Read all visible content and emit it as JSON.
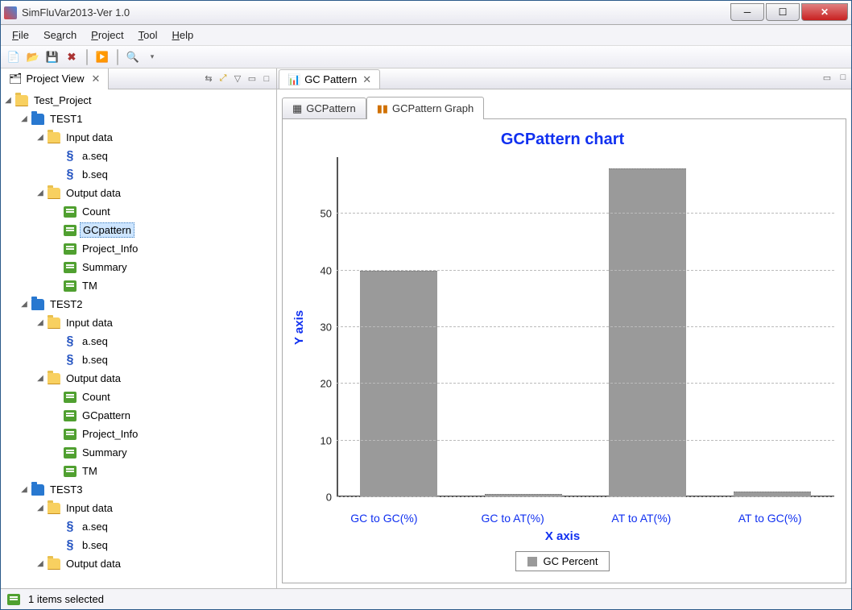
{
  "app": {
    "title": "SimFluVar2013-Ver 1.0"
  },
  "menu": {
    "file": "File",
    "search": "Search",
    "project": "Project",
    "tool": "Tool",
    "help": "Help"
  },
  "projectView": {
    "title": "Project View"
  },
  "tree": {
    "root": "Test_Project",
    "folders": [
      {
        "name": "TEST1",
        "input": "Input data",
        "output": "Output data",
        "seqs": [
          "a.seq",
          "b.seq"
        ],
        "outputs": [
          "Count",
          "GCpattern",
          "Project_Info",
          "Summary",
          "TM"
        ],
        "selected": "GCpattern"
      },
      {
        "name": "TEST2",
        "input": "Input data",
        "output": "Output data",
        "seqs": [
          "a.seq",
          "b.seq"
        ],
        "outputs": [
          "Count",
          "GCpattern",
          "Project_Info",
          "Summary",
          "TM"
        ]
      },
      {
        "name": "TEST3",
        "input": "Input data",
        "output": "Output data",
        "seqs": [
          "a.seq",
          "b.seq"
        ]
      }
    ]
  },
  "editor": {
    "tab": "GC Pattern",
    "innerTabs": {
      "table": "GCPattern",
      "graph": "GCPattern Graph"
    }
  },
  "chart_data": {
    "type": "bar",
    "title": "GCPattern chart",
    "xlabel": "X axis",
    "ylabel": "Y axis",
    "categories": [
      "GC to GC(%)",
      "GC to AT(%)",
      "AT to AT(%)",
      "AT to GC(%)"
    ],
    "values": [
      40,
      0.6,
      58,
      1.0
    ],
    "legend": "GC Percent",
    "ylim": [
      0,
      60
    ],
    "yticks": [
      0,
      10,
      20,
      30,
      40,
      50
    ]
  },
  "status": {
    "text": "1 items selected"
  }
}
